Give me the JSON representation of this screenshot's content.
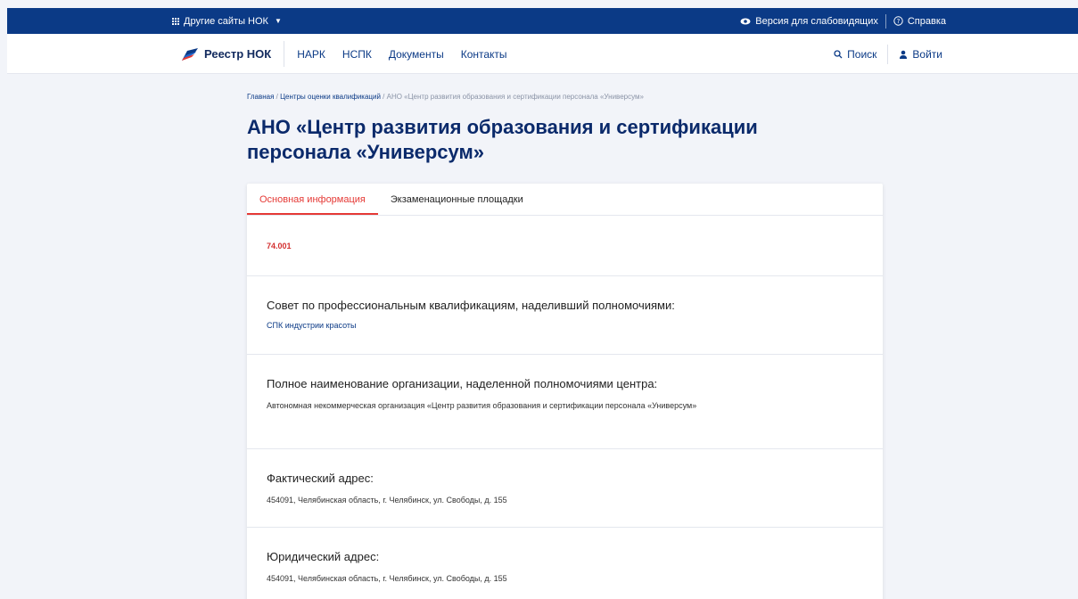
{
  "topbar": {
    "other_sites": "Другие сайты НОК",
    "accessibility": "Версия для слабовидящих",
    "help": "Справка"
  },
  "nav": {
    "logo_text": "Реестр НОК",
    "links": [
      "НАРК",
      "НСПК",
      "Документы",
      "Контакты"
    ],
    "search": "Поиск",
    "login": "Войти"
  },
  "breadcrumb": {
    "home": "Главная",
    "sep": " / ",
    "centers": "Центры оценки квалификаций",
    "current": "АНО «Центр развития образования и сертификации персонала «Универсум»"
  },
  "title": "АНО «Центр развития образования и сертификации персонала «Универсум»",
  "tabs": [
    "Основная информация",
    "Экзаменационные площадки"
  ],
  "code": "74.001",
  "council": {
    "heading": "Совет по профессиональным квалификациям, наделивший полномочиями:",
    "value": "СПК индустрии красоты"
  },
  "full_name": {
    "heading": "Полное наименование организации, наделенной полномочиями центра:",
    "value": "Автономная некоммерческая организация «Центр развития образования и сертификации персонала «Универсум»"
  },
  "actual_address": {
    "heading": "Фактический адрес:",
    "value": "454091, Челябинская область, г. Челябинск, ул. Свободы, д. 155"
  },
  "legal_address": {
    "heading": "Юридический адрес:",
    "value": "454091, Челябинская область, г. Челябинск, ул. Свободы, д. 155"
  },
  "colors": {
    "brand": "#0b3a86",
    "accent": "#e53935",
    "background": "#f2f4f9"
  }
}
